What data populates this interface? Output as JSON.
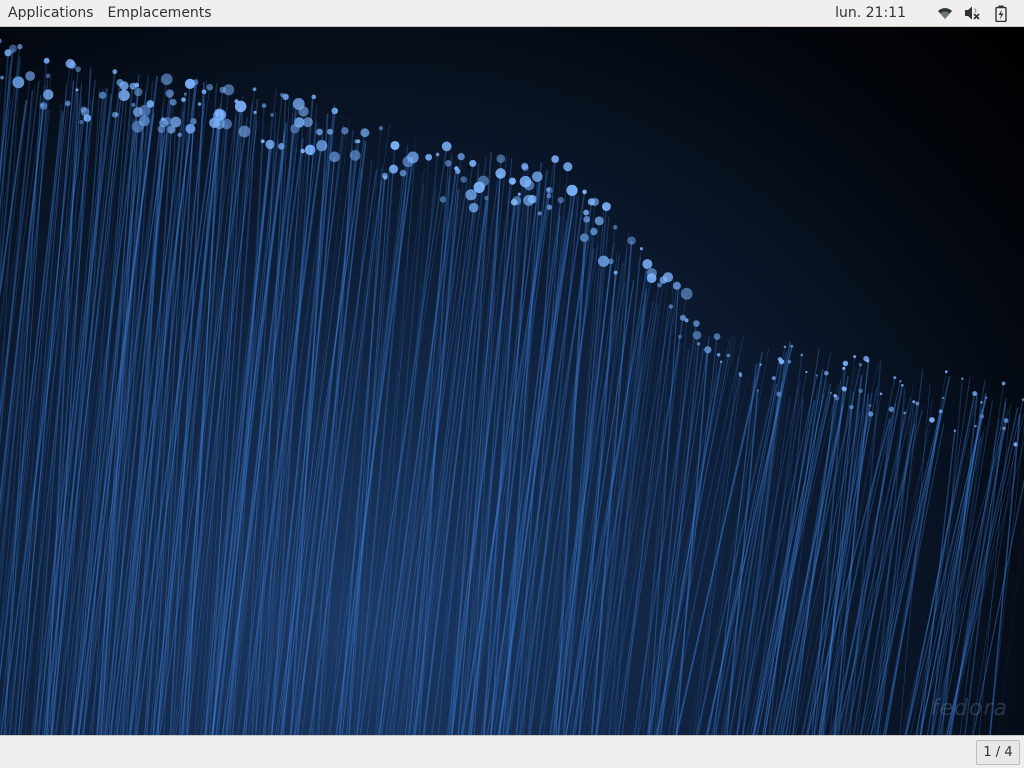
{
  "topbar": {
    "applications_label": "Applications",
    "places_label": "Emplacements",
    "clock": "lun. 21:11",
    "tray_icons": [
      "wifi-icon",
      "volume-muted-icon",
      "battery-charging-icon"
    ]
  },
  "desktop": {
    "watermark": "fedora"
  },
  "bottombar": {
    "workspace_indicator": "1 / 4"
  },
  "colors": {
    "panel_bg": "#f0efee",
    "panel_text": "#2e3436",
    "fiber_blue": "#3f7fd6",
    "fiber_tip": "#7fb6ff"
  }
}
